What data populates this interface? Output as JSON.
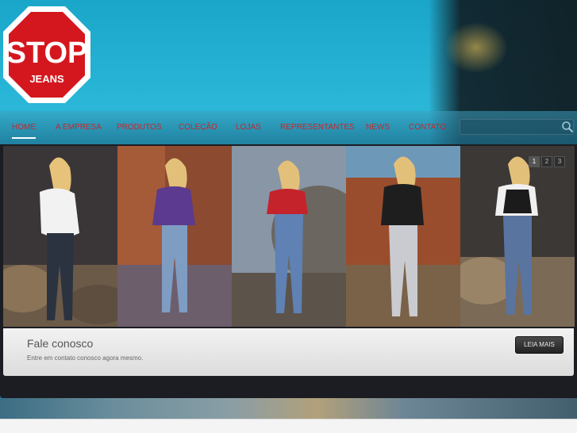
{
  "logo": {
    "line1": "STOP",
    "line2": "JEANS"
  },
  "nav": {
    "items": [
      "Home",
      "A Empresa",
      "Produtos",
      "Coleção",
      "Lojas",
      "Representantes",
      "News",
      "Contato"
    ]
  },
  "search": {
    "placeholder": ""
  },
  "slider": {
    "pages": [
      "1",
      "2",
      "3"
    ],
    "active_page": "1",
    "slides": [
      {
        "top": "white-blouse",
        "jeans": "dark-denim",
        "scene": "desert-dusk"
      },
      {
        "top": "purple-jacket",
        "jeans": "light-denim",
        "scene": "red-rocks"
      },
      {
        "top": "red-top",
        "jeans": "blue-denim",
        "scene": "grey-boulders"
      },
      {
        "top": "black-vest",
        "jeans": "light-denim",
        "scene": "canyon"
      },
      {
        "top": "white-shirt-black-vest",
        "jeans": "blue-denim",
        "scene": "rocky-dusk"
      }
    ]
  },
  "caption": {
    "title": "Fale conosco",
    "text": "Entre em contato conosco agora mesmo.",
    "button": "LEIA MAIS"
  }
}
